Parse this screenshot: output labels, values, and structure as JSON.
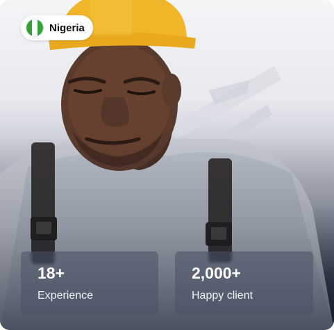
{
  "country": {
    "name": "Nigeria",
    "flag_icon": "nigeria-flag-icon",
    "flag_colors": [
      "#36a23b",
      "#ffffff",
      "#36a23b"
    ]
  },
  "photo": {
    "subject_icon": "construction-worker-photo"
  },
  "stats": [
    {
      "value": "18+",
      "label": "Experience"
    },
    {
      "value": "2,000+",
      "label": "Happy client"
    }
  ],
  "colors": {
    "hardhat": "#f1b52a",
    "stat_box": "#485266"
  }
}
